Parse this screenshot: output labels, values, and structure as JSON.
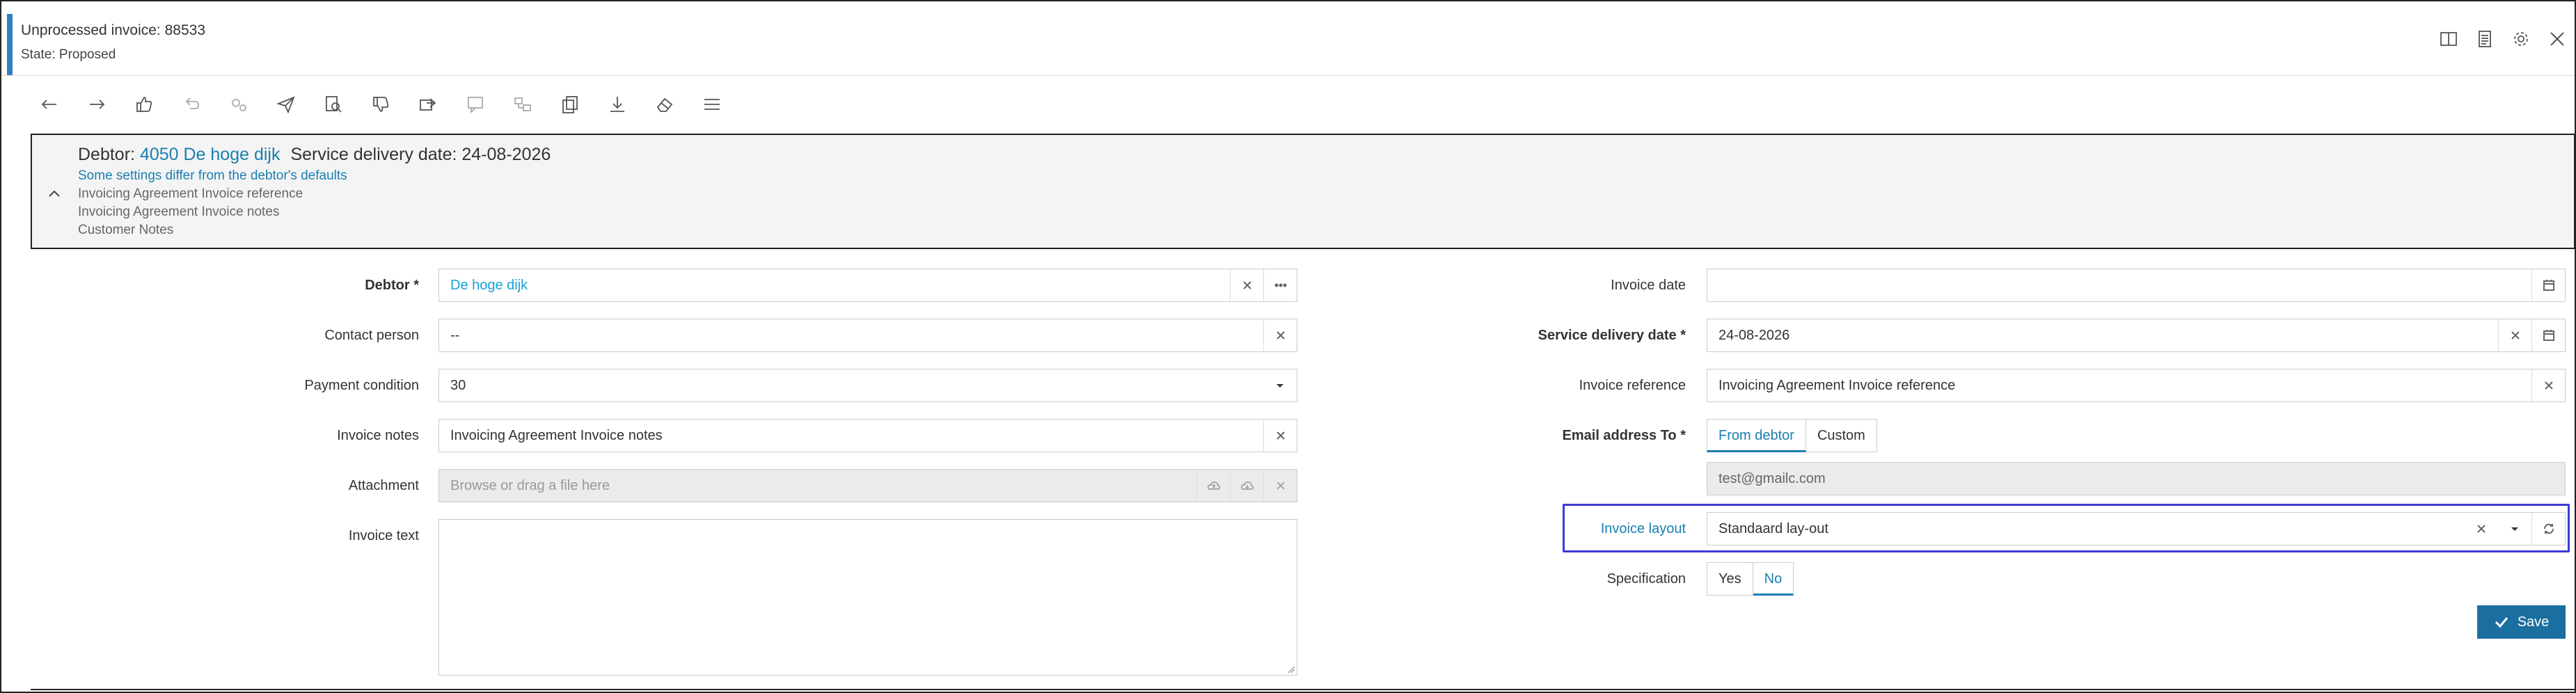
{
  "window": {
    "title": "Unprocessed invoice: 88533",
    "state": "State: Proposed",
    "actions": [
      "split-view-icon",
      "document-icon",
      "gear-icon",
      "close-icon"
    ]
  },
  "toolbar": {
    "icons": [
      "arrow-left-icon",
      "arrow-right-icon",
      "thumbs-up-icon",
      "undo-arrow-icon",
      "gears-icon",
      "send-icon",
      "document-search-icon",
      "thumbs-down-icon",
      "forward-icon",
      "comment-icon",
      "split-icon",
      "copy-icon",
      "download-icon",
      "eraser-icon",
      "menu-icon"
    ]
  },
  "summary": {
    "debtor_label": "Debtor:",
    "debtor_link": "4050 De hoge dijk",
    "service_delivery": "Service delivery date: 24-08-2026",
    "settings_notice": "Some settings differ from the debtor's defaults",
    "line_reference": "Invoicing Agreement Invoice reference",
    "line_notes": "Invoicing Agreement Invoice notes",
    "line_customer": "Customer Notes"
  },
  "left_form": {
    "debtor": {
      "label": "Debtor *",
      "value": "De hoge dijk"
    },
    "contact_person": {
      "label": "Contact person",
      "value": "--"
    },
    "payment_condition": {
      "label": "Payment condition",
      "value": "30"
    },
    "invoice_notes": {
      "label": "Invoice notes",
      "value": "Invoicing Agreement Invoice notes"
    },
    "attachment": {
      "label": "Attachment",
      "placeholder": "Browse or drag a file here"
    },
    "invoice_text": {
      "label": "Invoice text",
      "value": ""
    }
  },
  "right_form": {
    "invoice_date": {
      "label": "Invoice date",
      "value": ""
    },
    "service_delivery_date": {
      "label": "Service delivery date *",
      "value": "24-08-2026"
    },
    "invoice_reference": {
      "label": "Invoice reference",
      "value": "Invoicing Agreement Invoice reference"
    },
    "email_to": {
      "label": "Email address To *",
      "options": [
        "From debtor",
        "Custom"
      ],
      "selected": "From debtor",
      "value": "test@gmailc.com"
    },
    "invoice_layout": {
      "label": "Invoice layout",
      "value": "Standaard lay-out"
    },
    "specification": {
      "label": "Specification",
      "options": [
        "Yes",
        "No"
      ],
      "selected": "No"
    }
  },
  "save": {
    "label": "Save"
  },
  "colors": {
    "accent": "#2f7fbf",
    "link": "#1a7fb0",
    "save": "#1a6fa0",
    "highlight": "#3b3bd6"
  }
}
